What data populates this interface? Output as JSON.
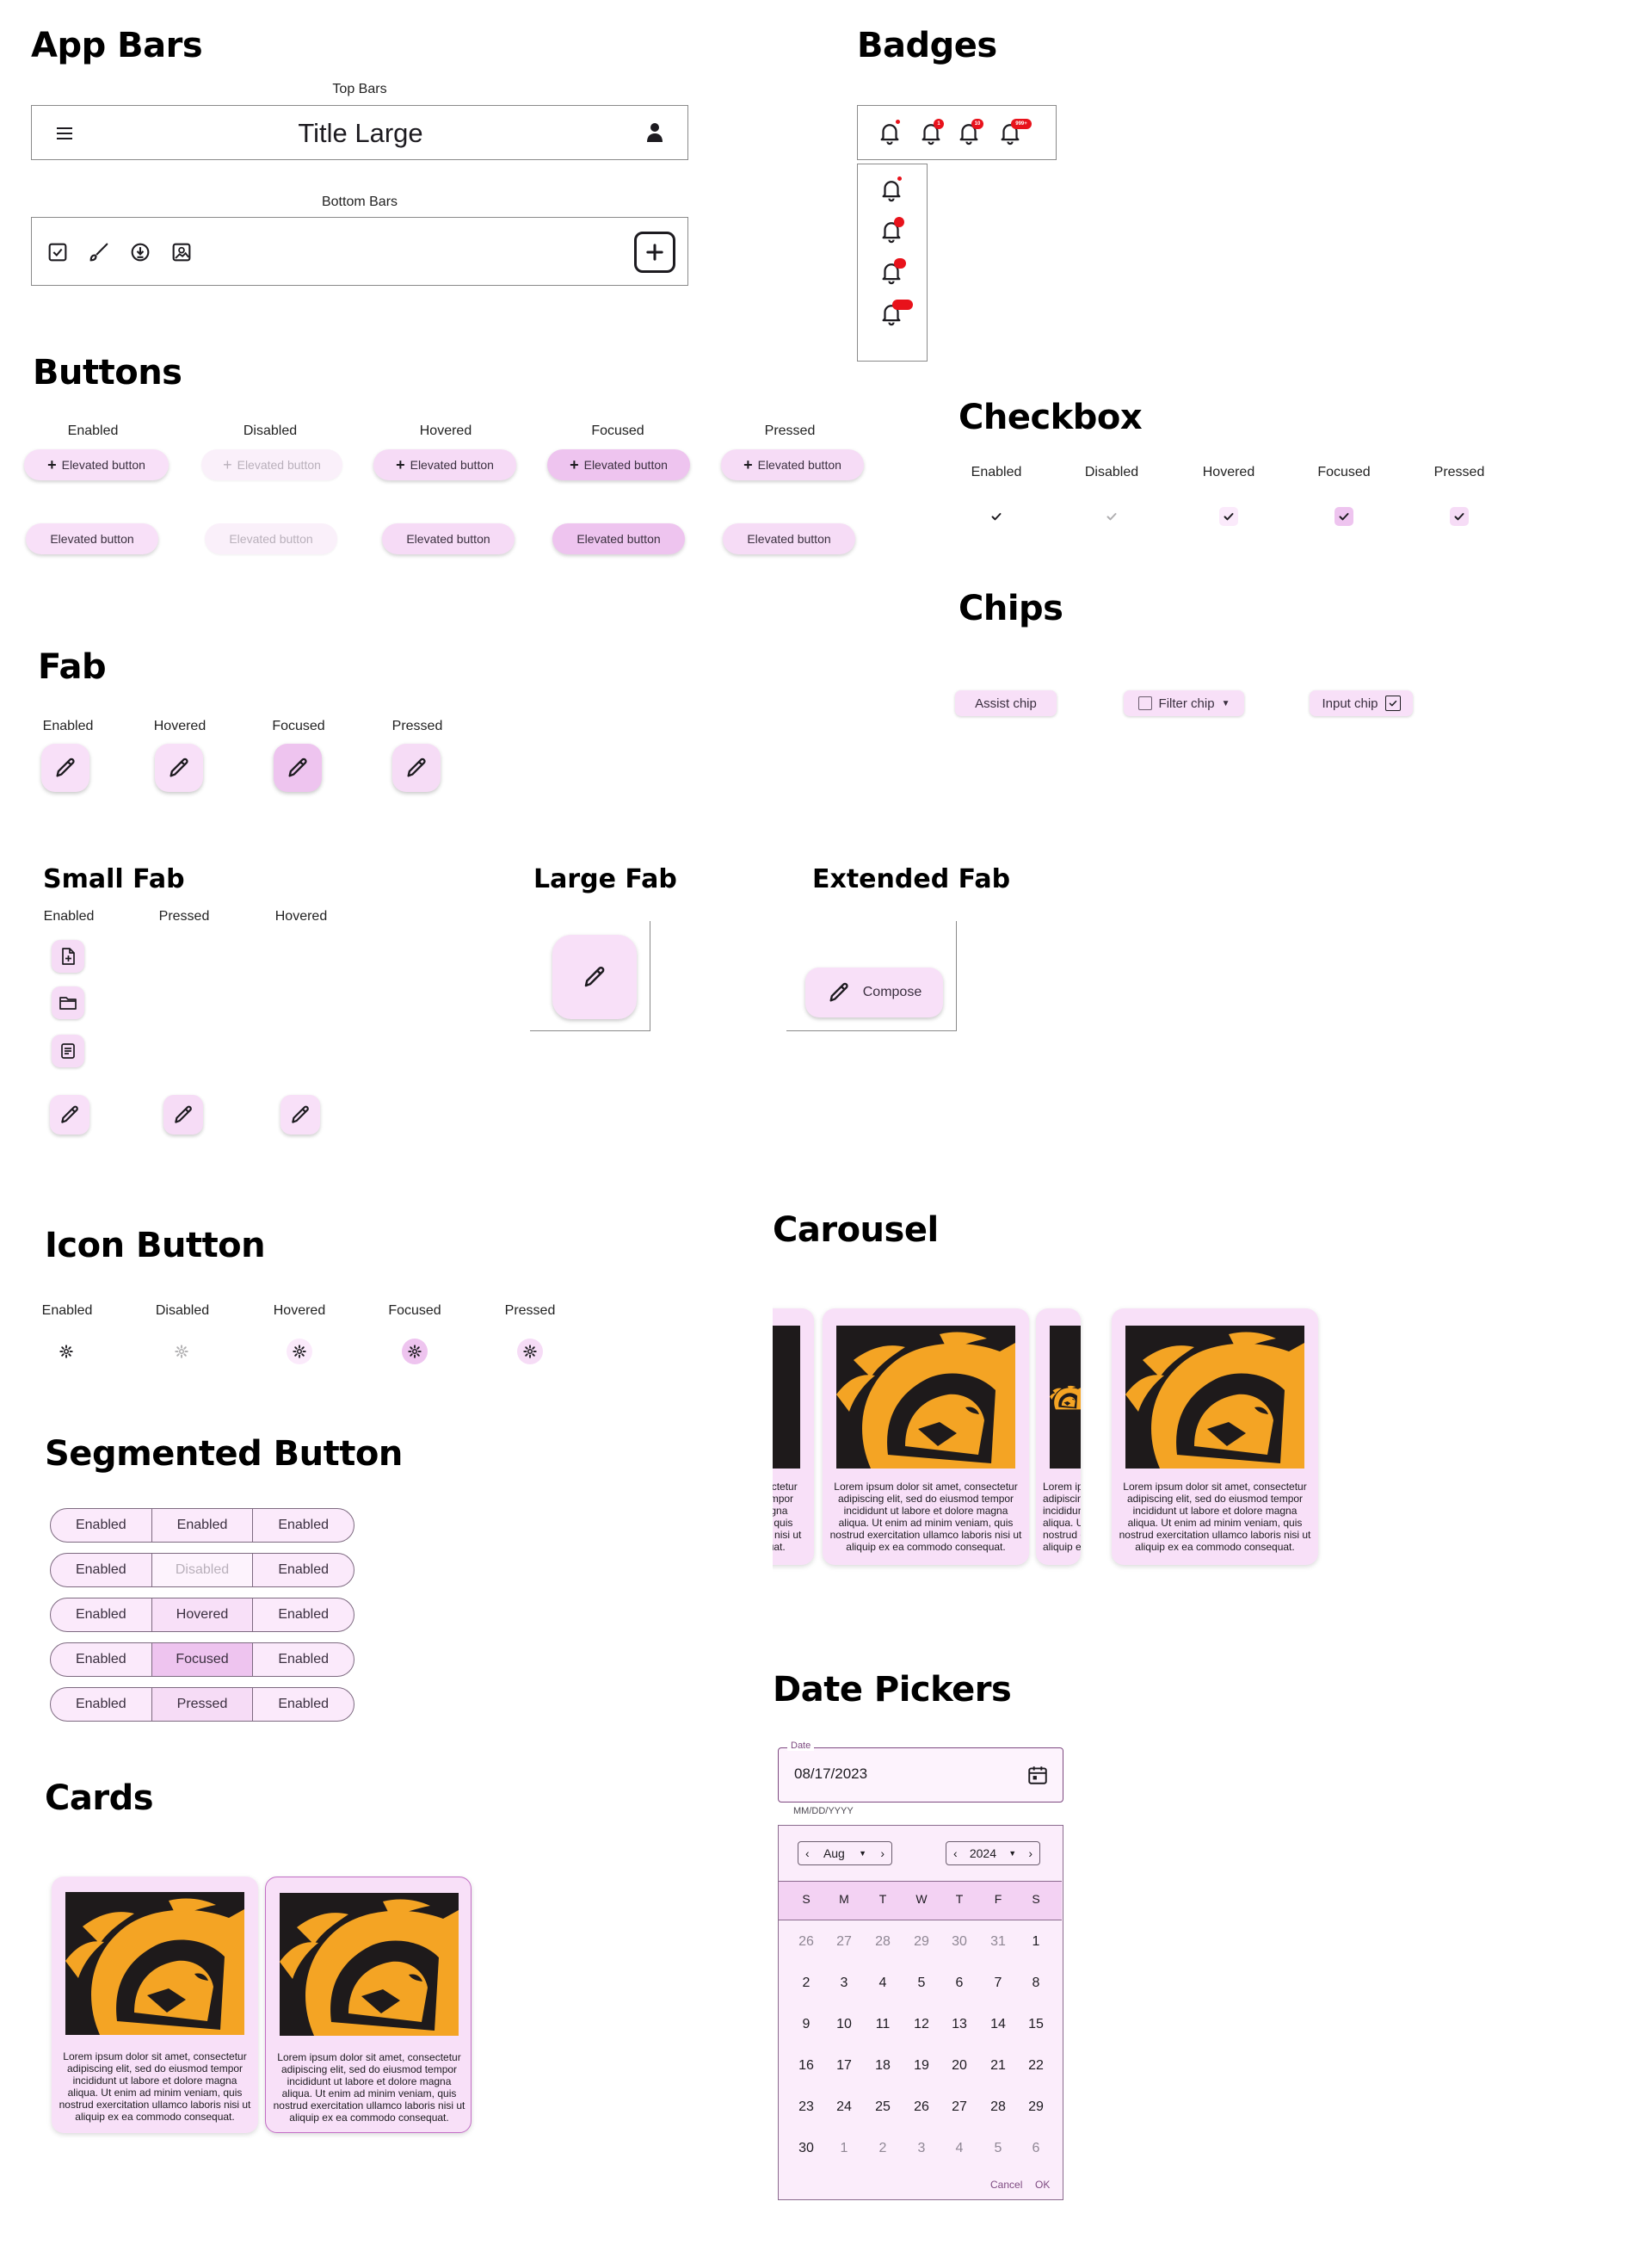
{
  "app_bars": {
    "title": "App Bars",
    "top_label": "Top Bars",
    "top_title": "Title Large",
    "bottom_label": "Bottom Bars"
  },
  "badges": {
    "title": "Badges",
    "counts": [
      "1",
      "10",
      "999+"
    ]
  },
  "buttons": {
    "title": "Buttons",
    "states": [
      "Enabled",
      "Disabled",
      "Hovered",
      "Focused",
      "Pressed"
    ],
    "label": "Elevated button"
  },
  "checkbox": {
    "title": "Checkbox",
    "states": [
      "Enabled",
      "Disabled",
      "Hovered",
      "Focused",
      "Pressed"
    ]
  },
  "chips": {
    "title": "Chips",
    "assist": "Assist chip",
    "filter": "Filter chip",
    "input": "Input chip"
  },
  "fab": {
    "title": "Fab",
    "states": [
      "Enabled",
      "Hovered",
      "Focused",
      "Pressed"
    ]
  },
  "small_fab": {
    "title": "Small Fab",
    "states": [
      "Enabled",
      "Pressed",
      "Hovered"
    ]
  },
  "large_fab": {
    "title": "Large Fab"
  },
  "extended_fab": {
    "title": "Extended Fab",
    "label": "Compose"
  },
  "icon_button": {
    "title": "Icon Button",
    "states": [
      "Enabled",
      "Disabled",
      "Hovered",
      "Focused",
      "Pressed"
    ]
  },
  "segmented": {
    "title": "Segmented Button",
    "rows": [
      [
        "Enabled",
        "Enabled",
        "Enabled"
      ],
      [
        "Enabled",
        "Disabled",
        "Enabled"
      ],
      [
        "Enabled",
        "Hovered",
        "Enabled"
      ],
      [
        "Enabled",
        "Focused",
        "Enabled"
      ],
      [
        "Enabled",
        "Pressed",
        "Enabled"
      ]
    ]
  },
  "cards": {
    "title": "Cards",
    "text": "Lorem ipsum dolor sit amet, consectetur adipiscing elit, sed do eiusmod tempor incididunt ut labore et dolore magna aliqua. Ut enim ad minim veniam, quis nostrud exercitation ullamco laboris nisi ut aliquip ex ea commodo consequat."
  },
  "carousel": {
    "title": "Carousel",
    "text": "Lorem ipsum dolor sit amet, consectetur adipiscing elit, sed do eiusmod tempor incididunt ut labore et dolore magna aliqua. Ut enim ad minim veniam, quis nostrud exercitation ullamco laboris nisi ut aliquip ex ea commodo consequat."
  },
  "date_picker": {
    "title": "Date Pickers",
    "field_label": "Date",
    "value": "08/17/2023",
    "hint": "MM/DD/YYYY",
    "month": "Aug",
    "year": "2024",
    "weekdays": [
      "S",
      "M",
      "T",
      "W",
      "T",
      "F",
      "S"
    ],
    "days": [
      [
        "26",
        "27",
        "28",
        "29",
        "30",
        "31",
        "1"
      ],
      [
        "2",
        "3",
        "4",
        "5",
        "6",
        "7",
        "8"
      ],
      [
        "9",
        "10",
        "11",
        "12",
        "13",
        "14",
        "15"
      ],
      [
        "16",
        "17",
        "18",
        "19",
        "20",
        "21",
        "22"
      ],
      [
        "23",
        "24",
        "25",
        "26",
        "27",
        "28",
        "29"
      ],
      [
        "30",
        "1",
        "2",
        "3",
        "4",
        "5",
        "6"
      ]
    ],
    "cancel": "Cancel",
    "ok": "OK"
  },
  "colors": {
    "surface_tint": "#f8e0f8",
    "focused": "#eec4ef",
    "badge": "#e8121b",
    "lion": "#f4a424"
  }
}
